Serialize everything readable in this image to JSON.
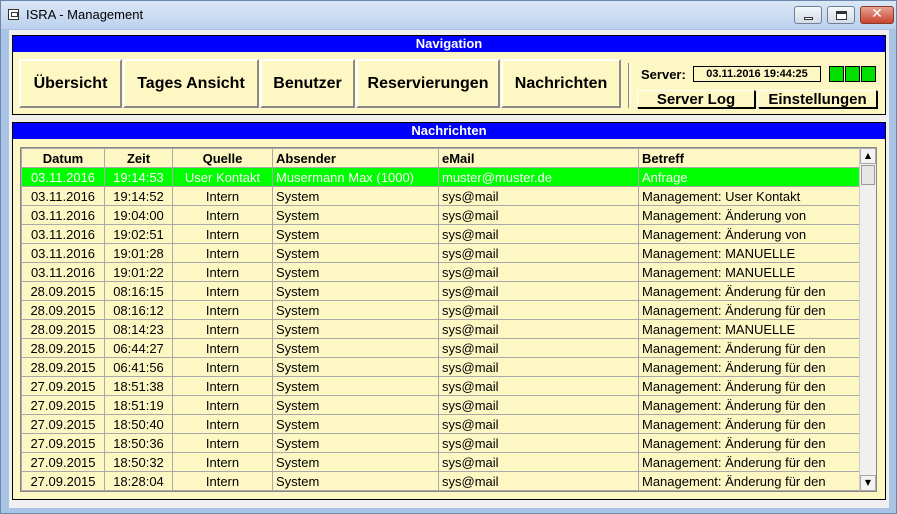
{
  "window": {
    "title": "ISRA - Management",
    "close_glyph": "✕"
  },
  "navigation": {
    "header": "Navigation",
    "buttons": [
      {
        "label": "Übersicht"
      },
      {
        "label": "Tages Ansicht"
      },
      {
        "label": "Benutzer"
      },
      {
        "label": "Reservierungen"
      },
      {
        "label": "Nachrichten"
      }
    ],
    "server_label": "Server:",
    "server_time": "03.11.2016 19:44:25",
    "status_color": "#00e000",
    "server_log_label": "Server Log",
    "settings_label": "Einstellungen"
  },
  "messages": {
    "header": "Nachrichten",
    "columns": [
      "Datum",
      "Zeit",
      "Quelle",
      "Absender",
      "eMail",
      "Betreff"
    ],
    "selected_row_color": "#00ff00",
    "rows": [
      [
        "03.11.2016",
        "19:14:53",
        "User Kontakt",
        "Musermann Max (1000)",
        "muster@muster.de",
        "Anfrage"
      ],
      [
        "03.11.2016",
        "19:14:52",
        "Intern",
        "System",
        "sys@mail",
        "Management: User Kontakt"
      ],
      [
        "03.11.2016",
        "19:04:00",
        "Intern",
        "System",
        "sys@mail",
        "Management: Änderung von"
      ],
      [
        "03.11.2016",
        "19:02:51",
        "Intern",
        "System",
        "sys@mail",
        "Management: Änderung von"
      ],
      [
        "03.11.2016",
        "19:01:28",
        "Intern",
        "System",
        "sys@mail",
        "Management: MANUELLE"
      ],
      [
        "03.11.2016",
        "19:01:22",
        "Intern",
        "System",
        "sys@mail",
        "Management: MANUELLE"
      ],
      [
        "28.09.2015",
        "08:16:15",
        "Intern",
        "System",
        "sys@mail",
        "Management: Änderung für den"
      ],
      [
        "28.09.2015",
        "08:16:12",
        "Intern",
        "System",
        "sys@mail",
        "Management: Änderung für den"
      ],
      [
        "28.09.2015",
        "08:14:23",
        "Intern",
        "System",
        "sys@mail",
        "Management: MANUELLE"
      ],
      [
        "28.09.2015",
        "06:44:27",
        "Intern",
        "System",
        "sys@mail",
        "Management: Änderung für den"
      ],
      [
        "28.09.2015",
        "06:41:56",
        "Intern",
        "System",
        "sys@mail",
        "Management: Änderung für den"
      ],
      [
        "27.09.2015",
        "18:51:38",
        "Intern",
        "System",
        "sys@mail",
        "Management: Änderung für den"
      ],
      [
        "27.09.2015",
        "18:51:19",
        "Intern",
        "System",
        "sys@mail",
        "Management: Änderung für den"
      ],
      [
        "27.09.2015",
        "18:50:40",
        "Intern",
        "System",
        "sys@mail",
        "Management: Änderung für den"
      ],
      [
        "27.09.2015",
        "18:50:36",
        "Intern",
        "System",
        "sys@mail",
        "Management: Änderung für den"
      ],
      [
        "27.09.2015",
        "18:50:32",
        "Intern",
        "System",
        "sys@mail",
        "Management: Änderung für den"
      ],
      [
        "27.09.2015",
        "18:28:04",
        "Intern",
        "System",
        "sys@mail",
        "Management: Änderung für den"
      ]
    ]
  },
  "scrollbar": {
    "up_glyph": "▲",
    "down_glyph": "▼"
  }
}
